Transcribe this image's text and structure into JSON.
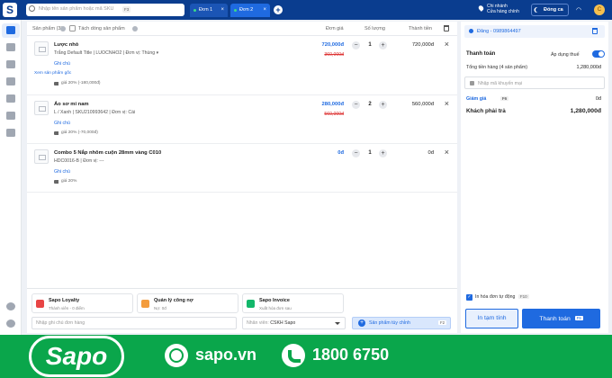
{
  "topbar": {
    "logo": "S",
    "search_placeholder": "Nhập tên sản phẩm hoặc mã SKU",
    "search_shortcut": "F3",
    "tabs": [
      {
        "label": "Đơn 1",
        "close": "×"
      },
      {
        "label": "Đơn 2",
        "close": "×"
      }
    ],
    "add_tab": "+",
    "branch_line1": "Chi nhánh",
    "branch_line2": "Cửa hàng chính",
    "shift_button": "Đóng ca",
    "avatar_initial": "C"
  },
  "product_list": {
    "header": {
      "products_label": "Sản phẩm (3)",
      "split_label": "Tách dòng sản phẩm",
      "unit_price": "Đơn giá",
      "quantity": "Số lượng",
      "total": "Thành tiền"
    },
    "items": [
      {
        "name": "Lược nhỏ",
        "sub": "Trắng Default Title  |  LUOCNHO2  |  Đơn vị: Thùng ▾",
        "note": "Ghi chú",
        "extra_link": "Xem sản phẩm gốc",
        "price_note": "giá 20% (-180,000đ)",
        "price": "720,000đ",
        "old_price": "360,000đ",
        "quantity": "1",
        "total": "720,000đ"
      },
      {
        "name": "Áo sơ mi nam",
        "sub": "L / Xanh  |  SKU210993642  |  Đơn vị: Cái",
        "note": "Ghi chú",
        "price_note": "giá 20% (-70,000đ)",
        "price": "280,000đ",
        "old_price": "560,000đ",
        "quantity": "2",
        "total": "560,000đ"
      },
      {
        "name": "Combo 5 Nắp nhôm cuộn 28mm vàng C010",
        "sub": "HDC0016-B  |  Đơn vị: ---",
        "note": "Ghi chú",
        "price_note": "giá 20%",
        "price": "0đ",
        "quantity": "1",
        "total": "0đ"
      }
    ]
  },
  "apps": [
    {
      "title": "Sapo Loyalty",
      "sub": "Thành viên - 0 điểm",
      "color": "#e84545"
    },
    {
      "title": "Quản lý công nợ",
      "sub": "Nợ: 0đ",
      "color": "#f39c3d"
    },
    {
      "title": "Sapo Invoice",
      "sub": "Xuất hóa đơn sau",
      "color": "#12b76a"
    }
  ],
  "order_note_placeholder": "Nhập ghi chú đơn hàng",
  "staff": {
    "label": "Nhân viên:",
    "value": "CSKH Sapo"
  },
  "custom_product": {
    "label": "Sản phẩm tùy chỉnh",
    "shortcut": "F2"
  },
  "checkout": {
    "customer": "Đăng - 0989864497",
    "payment_title": "Thanh toán",
    "apply_tax": "Áp dụng thuế",
    "subtotal_label": "Tổng tiền hàng (4 sản phẩm)",
    "subtotal_value": "1,280,000đ",
    "promo_placeholder": "Nhập mã khuyến mại",
    "discount_label": "Giảm giá",
    "discount_shortcut": "F6",
    "discount_value": "0đ",
    "pay_label": "Khách phải trả",
    "pay_value": "1,280,000đ",
    "print_label": "In hóa đơn tự động",
    "print_shortcut": "F10",
    "print_button": "In tạm tính",
    "pay_button": "Thanh toán",
    "pay_shortcut": "F9"
  },
  "banner": {
    "brand": "Sapo",
    "website": "sapo.vn",
    "hotline": "1800 6750"
  },
  "colors": {
    "primary": "#1f6ae0",
    "topbar": "#0a3d8f",
    "banner": "#0aa64b"
  }
}
